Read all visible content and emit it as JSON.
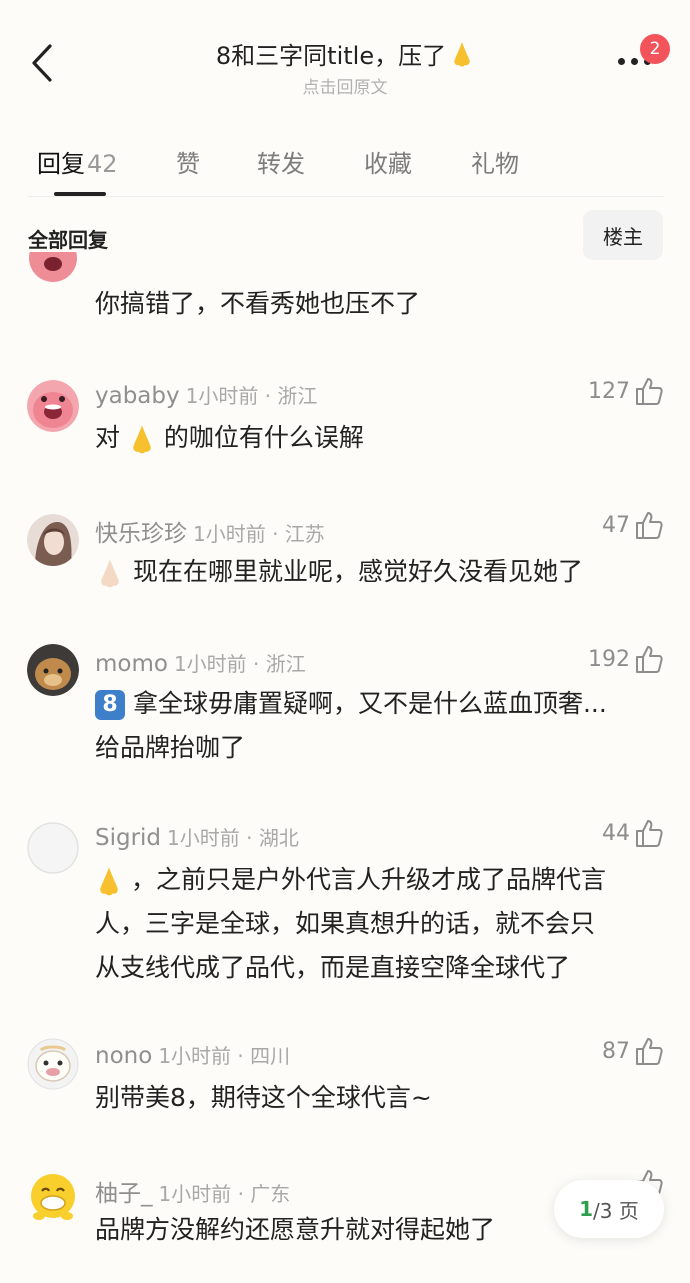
{
  "header": {
    "title": "8和三字同title，压了",
    "subtitle": "点击回原文",
    "notification_count": "2"
  },
  "tabs": [
    {
      "label": "回复",
      "count": "42"
    },
    {
      "label": "赞"
    },
    {
      "label": "转发"
    },
    {
      "label": "收藏"
    },
    {
      "label": "礼物"
    }
  ],
  "filter": {
    "label": "全部回复",
    "op_button": "楼主"
  },
  "comments": [
    {
      "name": "",
      "time": "",
      "likes": "",
      "text": "你搞错了，不看秀她也压不了"
    },
    {
      "name": "yababy",
      "time": "1小时前 · 浙江",
      "likes": "127",
      "text_before": "对",
      "text_after": "的咖位有什么误解"
    },
    {
      "name": "快乐珍珍",
      "time": "1小时前 · 江苏",
      "likes": "47",
      "text": "现在在哪里就业呢，感觉好久没看见她了"
    },
    {
      "name": "momo",
      "time": "1小时前 · 浙江",
      "likes": "192",
      "keycap": "8",
      "line1": "拿全球毋庸置疑啊，又不是什么蓝血顶奢...",
      "line2": "给品牌抬咖了"
    },
    {
      "name": "Sigrid",
      "time": "1小时前 · 湖北",
      "likes": "44",
      "line1": "，之前只是户外代言人升级才成了品牌代言",
      "line2": "人，三字是全球，如果真想升的话，就不会只",
      "line3": "从支线代成了品代，而是直接空降全球代了"
    },
    {
      "name": "nono",
      "time": "1小时前 · 四川",
      "likes": "87",
      "text": "别带美8，期待这个全球代言~"
    },
    {
      "name": "柚子_",
      "time": "1小时前 · 广东",
      "likes": "",
      "text": "品牌方没解约还愿意升就对得起她了"
    }
  ],
  "pager": {
    "current": "1",
    "total_text": "/3 页"
  }
}
